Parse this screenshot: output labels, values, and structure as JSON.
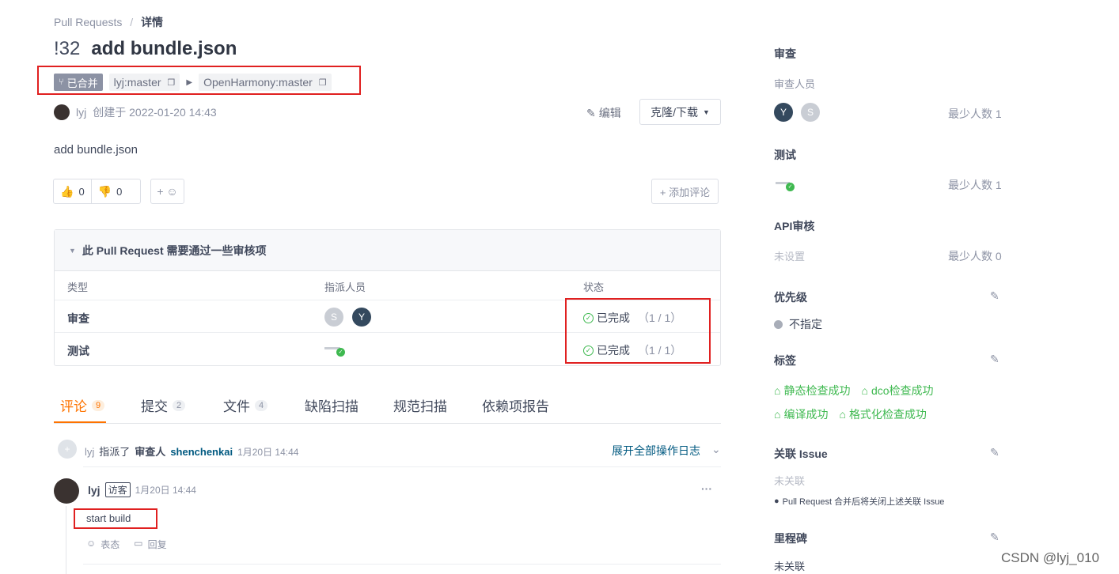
{
  "breadcrumb": {
    "parent": "Pull Requests",
    "sep": "/",
    "current": "详情"
  },
  "pr": {
    "number": "!32",
    "title": "add bundle.json",
    "status": "已合并",
    "source_branch": "lyj:master",
    "target_branch": "OpenHarmony:master",
    "author": "lyj",
    "created": "创建于 2022-01-20 14:43",
    "description": "add bundle.json"
  },
  "actions": {
    "edit": "编辑",
    "clone": "克隆/下载",
    "add_comment": "+ 添加评论",
    "emoji": "+ ☺"
  },
  "reactions": {
    "up": "0",
    "down": "0"
  },
  "checks": {
    "header": "此 Pull Request 需要通过一些审核项",
    "columns": [
      "类型",
      "指派人员",
      "状态"
    ],
    "rows": [
      {
        "type": "审查",
        "status": "已完成",
        "count": "（1 / 1）"
      },
      {
        "type": "测试",
        "status": "已完成",
        "count": "（1 / 1）"
      }
    ]
  },
  "tabs": [
    {
      "label": "评论",
      "count": "9"
    },
    {
      "label": "提交",
      "count": "2"
    },
    {
      "label": "文件",
      "count": "4"
    },
    {
      "label": "缺陷扫描",
      "count": ""
    },
    {
      "label": "规范扫描",
      "count": ""
    },
    {
      "label": "依赖项报告",
      "count": ""
    }
  ],
  "activity": {
    "user": "lyj",
    "action": "指派了",
    "role": "审查人",
    "target": "shenchenkai",
    "time": "1月20日 14:44",
    "expand": "展开全部操作日志"
  },
  "comment": {
    "user": "lyj",
    "badge": "访客",
    "time": "1月20日 14:44",
    "body": "start build",
    "react": "表态",
    "reply": "回复",
    "more": "···"
  },
  "sidebar": {
    "review": {
      "title": "审查",
      "sub": "审查人员",
      "min": "最少人数 1"
    },
    "test": {
      "title": "测试",
      "min": "最少人数 1"
    },
    "api": {
      "title": "API审核",
      "value": "未设置",
      "min": "最少人数 0"
    },
    "priority": {
      "title": "优先级",
      "value": "不指定"
    },
    "labels": {
      "title": "标签",
      "items": [
        "静态检查成功",
        "dco检查成功",
        "编译成功",
        "格式化检查成功"
      ]
    },
    "issue": {
      "title": "关联 Issue",
      "value": "未关联",
      "note": "Pull Request 合并后将关闭上述关联 Issue"
    },
    "milestone": {
      "title": "里程碑",
      "value": "未关联"
    }
  },
  "avatars": {
    "s": "S",
    "y": "Y"
  },
  "watermark": "CSDN @lyj_010",
  "colors": {
    "tab_active": "#fe7300",
    "green": "#3fb950",
    "link": "#005980",
    "annotation": "#e02020"
  }
}
